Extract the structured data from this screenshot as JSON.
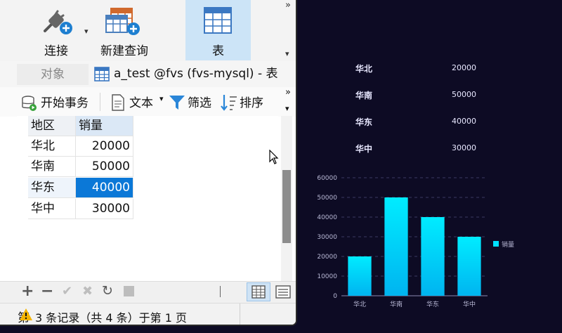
{
  "toolbar": {
    "connect_label": "连接",
    "new_query_label": "新建查询",
    "table_label": "表",
    "more": "»"
  },
  "tabs": {
    "object_label": "对象",
    "doc_title": "a_test @fvs (fvs-mysql) - 表"
  },
  "toolbar2": {
    "begin_tx": "开始事务",
    "text": "文本",
    "filter": "筛选",
    "sort": "排序",
    "more": "»"
  },
  "table": {
    "headers": [
      "地区",
      "销量"
    ],
    "rows": [
      [
        "华北",
        "20000"
      ],
      [
        "华南",
        "50000"
      ],
      [
        "华东",
        "40000"
      ],
      [
        "华中",
        "30000"
      ]
    ],
    "selected_row": 2
  },
  "status": {
    "text": "3 条记录（共 4 条）于第 1 页",
    "prefix_char": "第"
  },
  "right_list": [
    {
      "region": "华北",
      "value": "20000"
    },
    {
      "region": "华南",
      "value": "50000"
    },
    {
      "region": "华东",
      "value": "40000"
    },
    {
      "region": "华中",
      "value": "30000"
    }
  ],
  "chart_data": {
    "type": "bar",
    "categories": [
      "华北",
      "华南",
      "华东",
      "华中"
    ],
    "series": [
      {
        "name": "销量",
        "values": [
          20000,
          50000,
          40000,
          30000
        ]
      }
    ],
    "ylim": [
      0,
      60000
    ],
    "yticks": [
      "0",
      "10000",
      "20000",
      "30000",
      "40000",
      "50000",
      "60000"
    ],
    "legend": "right",
    "bar_color": "#00e0ff"
  }
}
